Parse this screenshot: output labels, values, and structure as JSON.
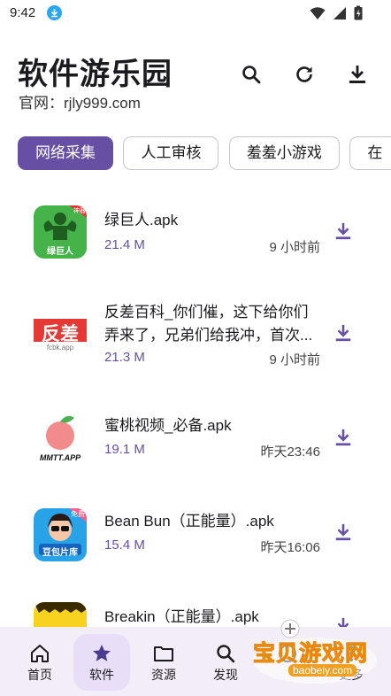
{
  "status": {
    "time": "9:42"
  },
  "header": {
    "title": "软件游乐园",
    "subtitle": "官网：rjly999.com"
  },
  "actions": {
    "search_icon": "search-icon",
    "refresh_icon": "refresh-icon",
    "download_icon": "download-icon"
  },
  "tabs": [
    {
      "label": "网络采集",
      "active": true
    },
    {
      "label": "人工审核",
      "active": false
    },
    {
      "label": "羞羞小游戏",
      "active": false
    },
    {
      "label": "在",
      "active": false
    }
  ],
  "items": [
    {
      "name": "绿巨人.apk",
      "size": "21.4 M",
      "time": "9 小时前",
      "icon_caption": "绿巨人",
      "badge": "神器"
    },
    {
      "name": "反差百科_你们催，这下给你们弄来了，兄弟们给我冲，首次...",
      "size": "21.3 M",
      "time": "9 小时前",
      "icon_caption": "反差",
      "badge": "fcbk.app"
    },
    {
      "name": "蜜桃视频_必备.apk",
      "size": "19.1 M",
      "time": "昨天23:46",
      "icon_caption": "MMTT.APP",
      "badge": ""
    },
    {
      "name": "Bean Bun（正能量）.apk",
      "size": "15.4 M",
      "time": "昨天16:06",
      "icon_caption": "豆包片库",
      "badge": "免费"
    },
    {
      "name": "Breakin（正能量）.apk",
      "size": "",
      "time": "",
      "icon_caption": "",
      "badge": ""
    }
  ],
  "nav": [
    {
      "label": "首页",
      "icon": "home-icon"
    },
    {
      "label": "软件",
      "icon": "star-icon",
      "active": true
    },
    {
      "label": "资源",
      "icon": "folder-icon"
    },
    {
      "label": "发现",
      "icon": "search-icon"
    },
    {
      "label": "",
      "icon": "info-icon"
    },
    {
      "label": "更多",
      "icon": "more-icon"
    }
  ],
  "watermark": {
    "text": "宝贝游戏网",
    "url": "baobeiy.com"
  },
  "colors": {
    "accent": "#6750a4",
    "nav_bg": "#f3edf7"
  }
}
